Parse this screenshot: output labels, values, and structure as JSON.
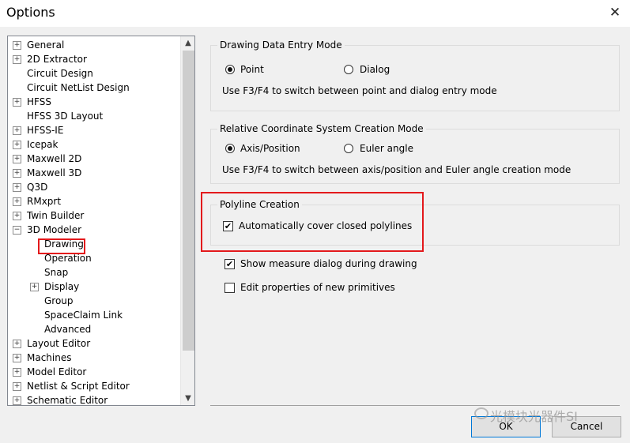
{
  "window": {
    "title": "Options",
    "close_icon": "close-icon"
  },
  "tree": {
    "items": [
      {
        "label": "General",
        "expander": "+"
      },
      {
        "label": "2D Extractor",
        "expander": "+"
      },
      {
        "label": "Circuit Design",
        "expander": ""
      },
      {
        "label": "Circuit NetList Design",
        "expander": ""
      },
      {
        "label": "HFSS",
        "expander": "+"
      },
      {
        "label": "HFSS 3D Layout",
        "expander": ""
      },
      {
        "label": "HFSS-IE",
        "expander": "+"
      },
      {
        "label": "Icepak",
        "expander": "+"
      },
      {
        "label": "Maxwell 2D",
        "expander": "+"
      },
      {
        "label": "Maxwell 3D",
        "expander": "+"
      },
      {
        "label": "Q3D",
        "expander": "+"
      },
      {
        "label": "RMxprt",
        "expander": "+"
      },
      {
        "label": "Twin Builder",
        "expander": "+"
      },
      {
        "label": "3D Modeler",
        "expander": "−"
      },
      {
        "label": "Drawing",
        "expander": ""
      },
      {
        "label": "Operation",
        "expander": ""
      },
      {
        "label": "Snap",
        "expander": ""
      },
      {
        "label": "Display",
        "expander": "+"
      },
      {
        "label": "Group",
        "expander": ""
      },
      {
        "label": "SpaceClaim Link",
        "expander": ""
      },
      {
        "label": "Advanced",
        "expander": ""
      },
      {
        "label": "Layout Editor",
        "expander": "+"
      },
      {
        "label": "Machines",
        "expander": "+"
      },
      {
        "label": "Model Editor",
        "expander": "+"
      },
      {
        "label": "Netlist & Script Editor",
        "expander": "+"
      },
      {
        "label": "Schematic Editor",
        "expander": "+"
      }
    ],
    "selected": "Drawing"
  },
  "drawing_mode": {
    "title": "Drawing Data Entry Mode",
    "option_point": "Point",
    "option_dialog": "Dialog",
    "selected": "Point",
    "hint": "Use F3/F4 to switch between point and dialog entry mode"
  },
  "relative_cs": {
    "title": "Relative Coordinate System Creation Mode",
    "option_axis": "Axis/Position",
    "option_euler": "Euler angle",
    "selected": "Axis/Position",
    "hint": "Use F3/F4 to switch between axis/position and Euler angle creation mode"
  },
  "polyline": {
    "title": "Polyline Creation",
    "auto_cover_label": "Automatically cover closed polylines",
    "auto_cover_checked": true
  },
  "show_measure": {
    "label": "Show measure dialog during drawing",
    "checked": true
  },
  "edit_properties": {
    "label": "Edit properties of new primitives",
    "checked": false
  },
  "buttons": {
    "ok": "OK",
    "cancel": "Cancel"
  },
  "watermark": "光模块光器件SI",
  "colors": {
    "highlight": "#e3191c",
    "default_button_border": "#0078d7"
  }
}
